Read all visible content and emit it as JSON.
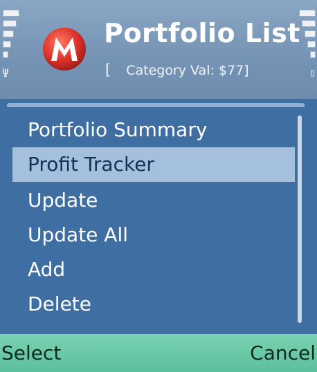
{
  "status": {
    "signal_icon": "signal-strength-icon",
    "antenna_symbol": "Ψ",
    "battery_icon": "battery-level-icon",
    "battery_symbol": "▯"
  },
  "header": {
    "title": "Portfolio List",
    "subtitle_open": "[",
    "subtitle_value": "Category Val: $77]",
    "app_icon": "app-logo-icon"
  },
  "menu": {
    "items": [
      {
        "label": "Portfolio Summary"
      },
      {
        "label": "Profit Tracker"
      },
      {
        "label": "Update"
      },
      {
        "label": "Update All"
      },
      {
        "label": "Add"
      },
      {
        "label": "Delete"
      }
    ],
    "selected_index": 1
  },
  "softkeys": {
    "left": "Select",
    "right": "Cancel"
  },
  "colors": {
    "header": "#7593b4",
    "menu_background": "#3f6fa2",
    "selection": "#a5c0dc",
    "softkey_bar": "#5cbf9d"
  }
}
